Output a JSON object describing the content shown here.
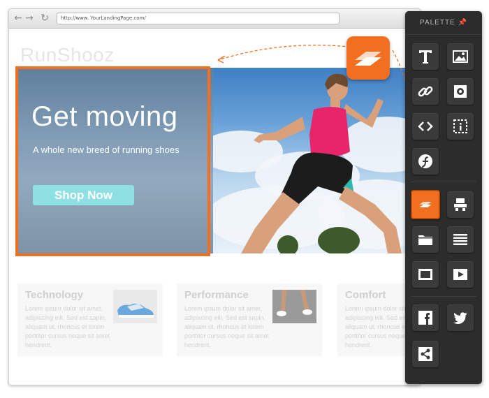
{
  "browser": {
    "url": "http://www. YourLandingPage.com/",
    "back_icon": "back-arrow-icon",
    "forward_icon": "forward-arrow-icon",
    "reload_icon": "reload-icon"
  },
  "site": {
    "logo": "RunShooz"
  },
  "hero": {
    "title": "Get moving",
    "subtitle": "A whole new breed of running shoes",
    "cta_label": "Shop Now"
  },
  "features": [
    {
      "title": "Technology",
      "text": "Lorem ipsum dolor sit amet, adipiscing elit. Sed est sapin, aliquam ut, rhoncus et lorem porttitor cursus neque sit amet hendrerit."
    },
    {
      "title": "Performance",
      "text": "Lorem ipsum dolor sit amet, adipiscing elit. Sed est sapin, aliquam ut, rhoncus et lorem porttitor cursus neque sit amet hendrerit."
    },
    {
      "title": "Comfort",
      "text": "Lorem ipsum dolor sit amet, adipiscing elit. Sed est sapin, aliquam ut, rhoncus et lorem porttitor cursus neque sit amet hendrerit."
    }
  ],
  "palette": {
    "header": "PALETTE",
    "pin_icon": "pin-icon",
    "items": [
      {
        "name": "text-icon"
      },
      {
        "name": "image-icon"
      },
      {
        "name": "link-icon"
      },
      {
        "name": "gear-icon"
      },
      {
        "name": "code-icon"
      },
      {
        "name": "info-icon"
      },
      {
        "name": "flash-icon"
      },
      {
        "name": "layers-icon"
      },
      {
        "name": "form-icon"
      },
      {
        "name": "folder-icon"
      },
      {
        "name": "list-icon"
      },
      {
        "name": "window-icon"
      },
      {
        "name": "video-play-icon"
      },
      {
        "name": "facebook-icon"
      },
      {
        "name": "twitter-icon"
      },
      {
        "name": "share-icon"
      }
    ]
  },
  "colors": {
    "accent": "#f26f1f",
    "palette_bg": "#2c2c2c",
    "cta": "#8fe0e3",
    "tank_top": "#e8246a"
  }
}
